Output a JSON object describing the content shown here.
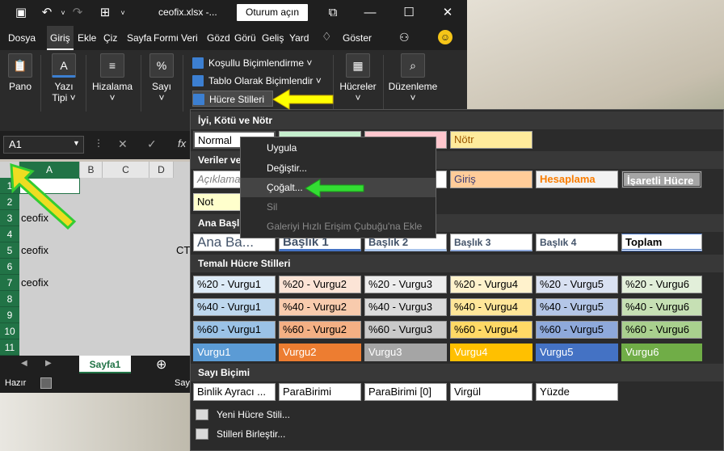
{
  "window": {
    "title": "ceofix.xlsx  -...",
    "signin": "Oturum açın"
  },
  "menubar": {
    "tabs": [
      "Dosya",
      "Giriş",
      "Ekle",
      "Çiz",
      "Sayfa",
      "Formü",
      "Veri",
      "Gözd",
      "Görü",
      "Geliş",
      "Yard",
      "Göster"
    ]
  },
  "ribbon": {
    "groups": [
      {
        "label1": "Pano",
        "label2": "",
        "icon": "paste-icon"
      },
      {
        "label1": "Yazı",
        "label2": "Tipi ˅",
        "icon": "font-icon"
      },
      {
        "label1": "Hizalama",
        "label2": "˅",
        "icon": "align-icon"
      },
      {
        "label1": "Sayı",
        "label2": "˅",
        "icon": "percent-icon"
      },
      {
        "label1": "Hücreler",
        "label2": "˅",
        "icon": "cells-icon"
      },
      {
        "label1": "Düzenleme",
        "label2": "˅",
        "icon": "find-icon"
      }
    ],
    "styles_items": [
      "Koşullu Biçimlendirme ˅",
      "Tablo Olarak Biçimlendir ˅",
      "Hücre Stilleri ˅"
    ]
  },
  "formulabar": {
    "namebox": "A1"
  },
  "grid": {
    "columns": [
      "A",
      "B",
      "C",
      "D"
    ],
    "rows": [
      "1",
      "2",
      "3",
      "4",
      "5",
      "6",
      "7",
      "8",
      "9",
      "10",
      "11"
    ],
    "cells": {
      "r3": "ceofix",
      "r5": "ceofix",
      "r7": "ceofix",
      "r5_d": "CT"
    }
  },
  "sheets": {
    "active": "Sayfa1",
    "add": "⊕"
  },
  "status": {
    "ready": "Hazır",
    "overflow": "Say"
  },
  "panel": {
    "sections": {
      "good_bad": "İyi, Kötü ve Nötr",
      "data_model": "Veriler ve",
      "titles": "Ana Başlık",
      "themed": "Temalı Hücre Stilleri",
      "number": "Sayı Biçimi"
    },
    "row1": [
      "Normal",
      "Nötr"
    ],
    "row2": [
      "Açıklama...",
      "Giriş",
      "Hesaplama",
      "İşaretli Hücre"
    ],
    "row3": [
      "Not"
    ],
    "row4": [
      "Ana Ba...",
      "Başlık 1",
      "Başlık 2",
      "Başlık 3",
      "Başlık 4",
      "Toplam"
    ],
    "row20": [
      "%20 - Vurgu1",
      "%20 - Vurgu2",
      "%20 - Vurgu3",
      "%20 - Vurgu4",
      "%20 - Vurgu5",
      "%20 - Vurgu6"
    ],
    "row40": [
      "%40 - Vurgu1",
      "%40 - Vurgu2",
      "%40 - Vurgu3",
      "%40 - Vurgu4",
      "%40 - Vurgu5",
      "%40 - Vurgu6"
    ],
    "row60": [
      "%60 - Vurgu1",
      "%60 - Vurgu2",
      "%60 - Vurgu3",
      "%60 - Vurgu4",
      "%60 - Vurgu5",
      "%60 - Vurgu6"
    ],
    "rowacc": [
      "Vurgu1",
      "Vurgu2",
      "Vurgu3",
      "Vurgu4",
      "Vurgu5",
      "Vurgu6"
    ],
    "rownum": [
      "Binlik Ayracı ...",
      "ParaBirimi",
      "ParaBirimi [0]",
      "Virgül",
      "Yüzde"
    ],
    "footer": [
      "Yeni Hücre Stili...",
      "Stilleri Birleştir..."
    ]
  },
  "context_menu": {
    "items": [
      "Uygula",
      "Değiştir...",
      "Çoğalt...",
      "Sil",
      "Galeriyi Hızlı Erişim Çubuğu'na Ekle"
    ]
  },
  "colors": {
    "excel_green": "#217346",
    "accent1": "#5b9bd5",
    "accent2": "#ed7d31",
    "accent3": "#a5a5a5",
    "accent4": "#ffc000",
    "accent5": "#4472c4",
    "accent6": "#70ad47",
    "annotation_yellow": "#ffff00",
    "annotation_green": "#33dd33"
  }
}
